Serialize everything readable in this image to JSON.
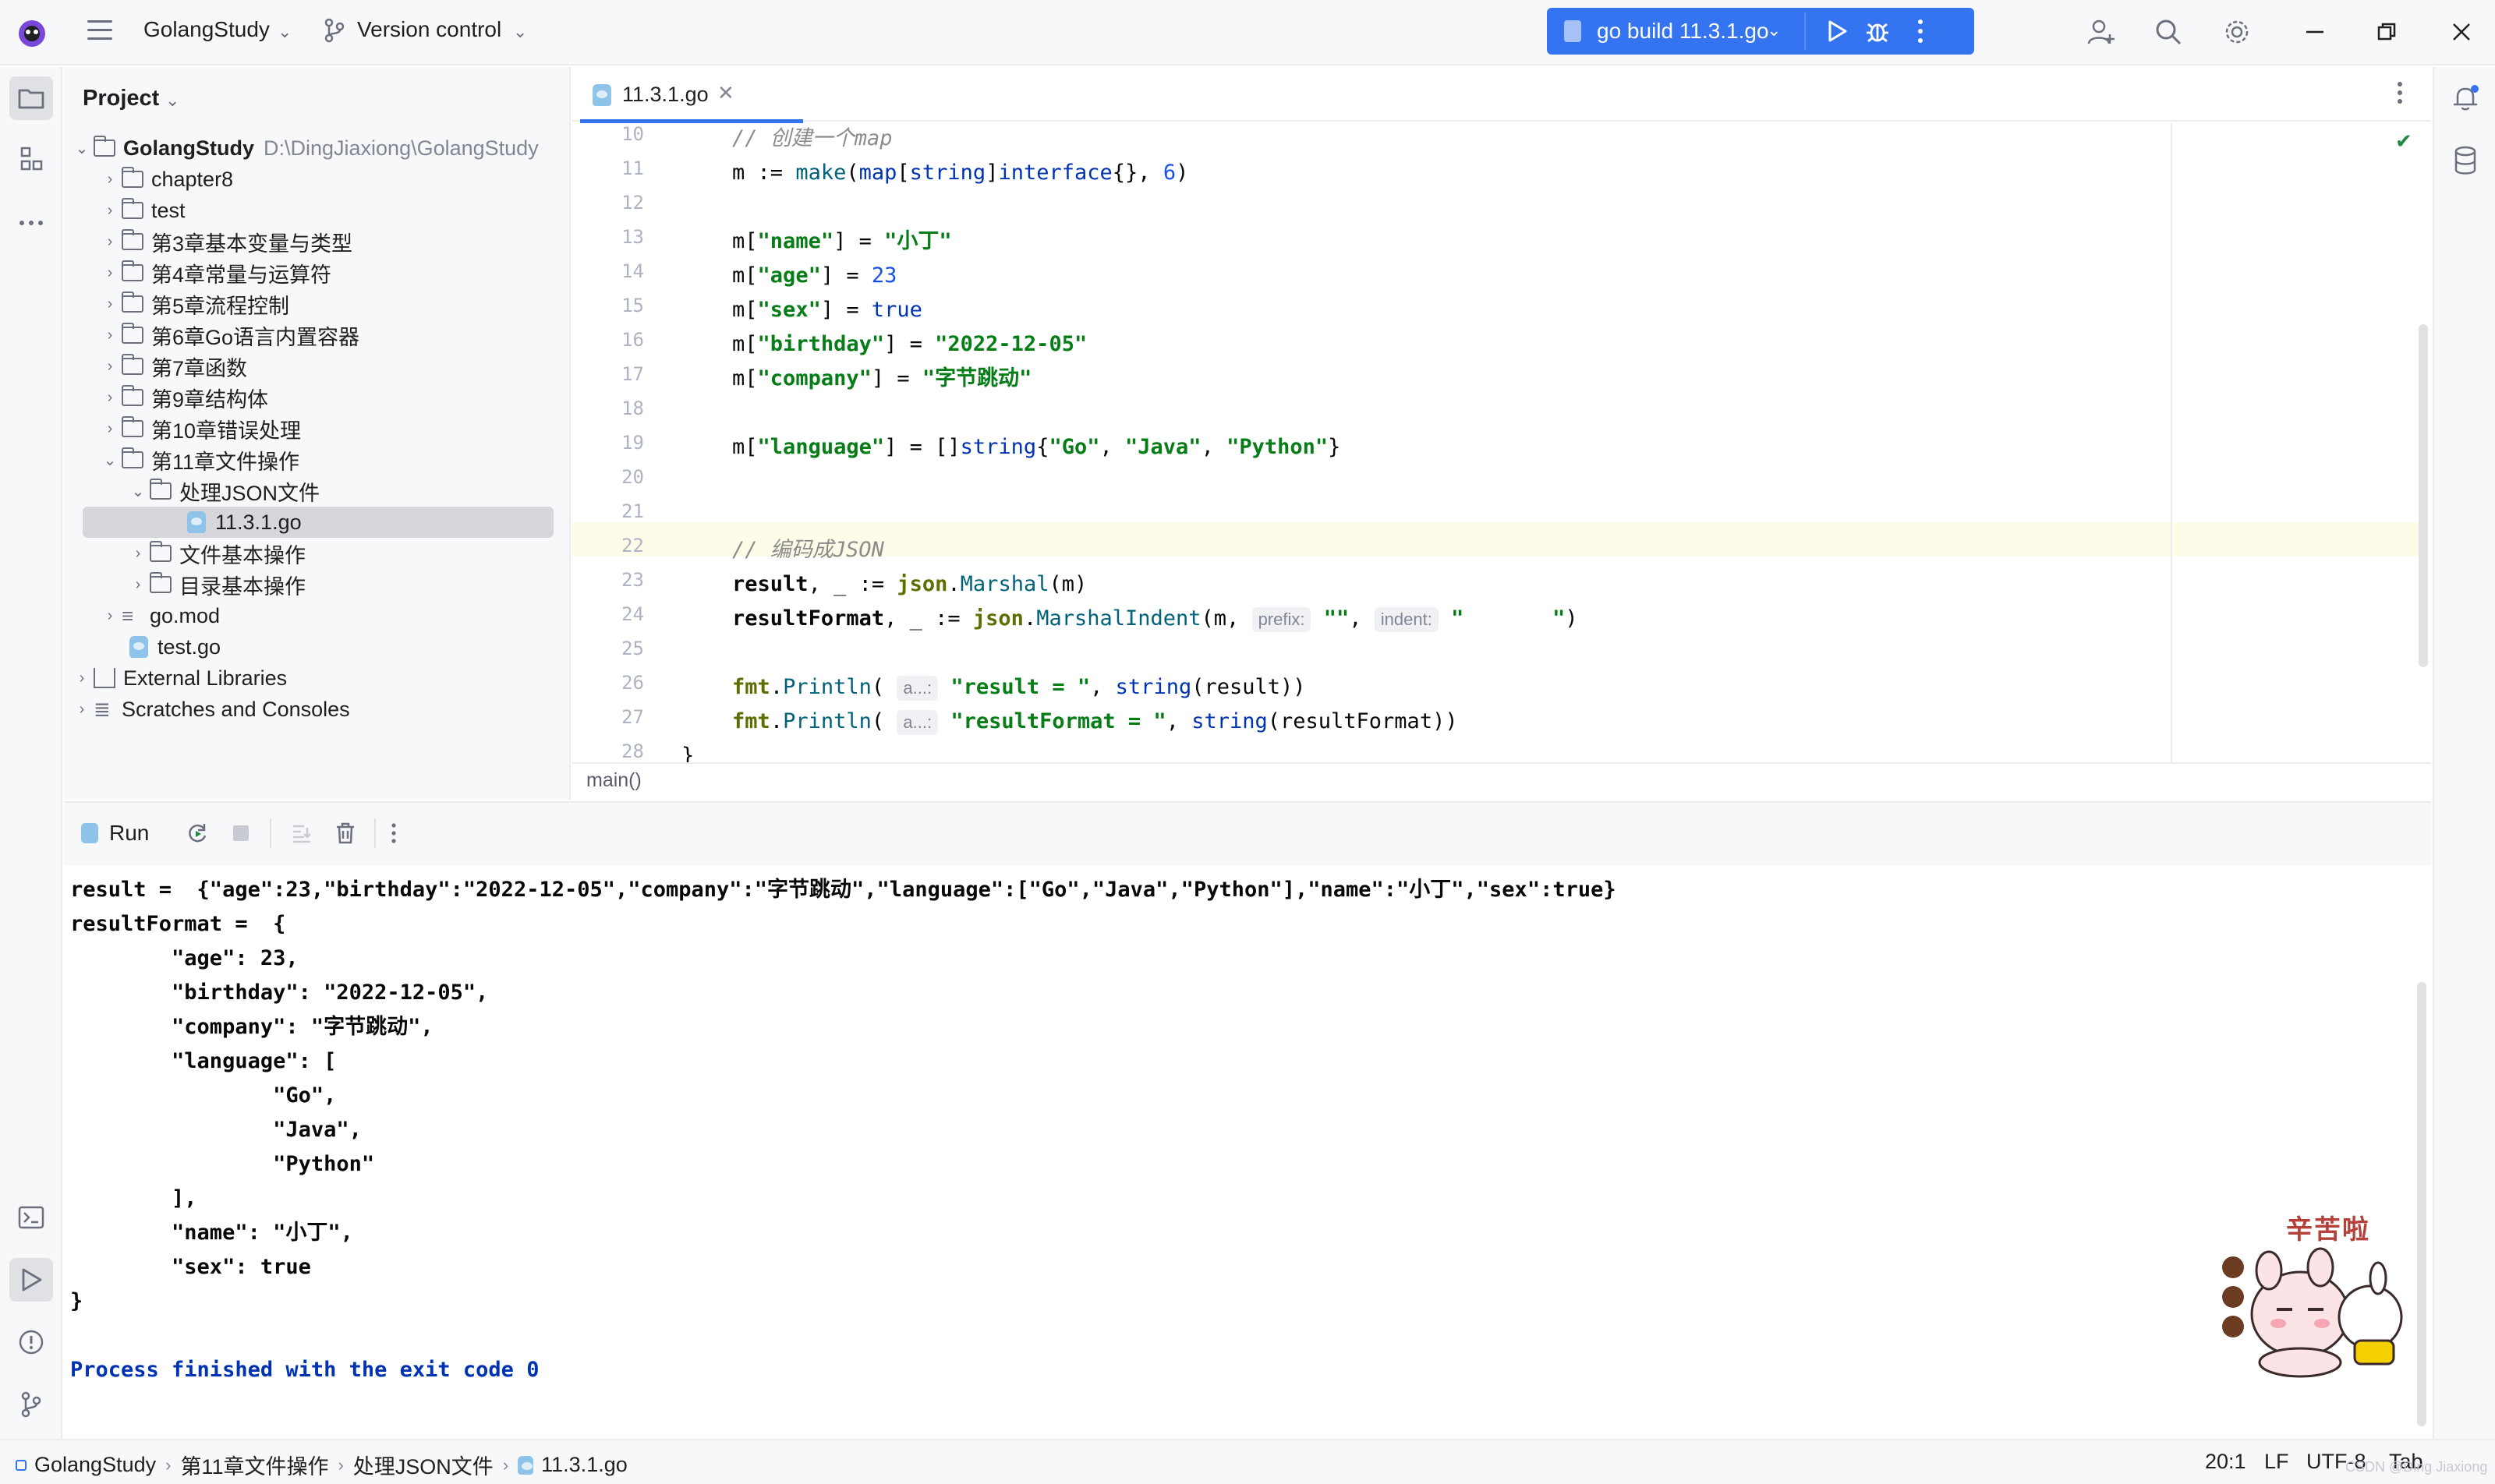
{
  "titlebar": {
    "project_name": "GolangStudy",
    "version_control": "Version control",
    "run_config": "go build 11.3.1.go"
  },
  "left_strip": {
    "icons": [
      "project-icon",
      "structure-icon",
      "more-icon",
      "terminal-icon",
      "run-icon",
      "problems-icon",
      "git-icon"
    ]
  },
  "project_panel": {
    "header": "Project",
    "root_name": "GolangStudy",
    "root_path": "D:\\DingJiaxiong\\GolangStudy",
    "items": [
      {
        "label": "chapter8"
      },
      {
        "label": "test"
      },
      {
        "label": "第3章基本变量与类型"
      },
      {
        "label": "第4章常量与运算符"
      },
      {
        "label": "第5章流程控制"
      },
      {
        "label": "第6章Go语言内置容器"
      },
      {
        "label": "第7章函数"
      },
      {
        "label": "第9章结构体"
      },
      {
        "label": "第10章错误处理"
      },
      {
        "label": "第11章文件操作"
      },
      {
        "label": "处理JSON文件"
      },
      {
        "label": "11.3.1.go"
      },
      {
        "label": "文件基本操作"
      },
      {
        "label": "目录基本操作"
      },
      {
        "label": "go.mod"
      },
      {
        "label": "test.go"
      },
      {
        "label": "External Libraries"
      },
      {
        "label": "Scratches and Consoles"
      }
    ]
  },
  "editor": {
    "tab_label": "11.3.1.go",
    "line_numbers": [
      "10",
      "11",
      "12",
      "13",
      "14",
      "15",
      "16",
      "17",
      "18",
      "19",
      "20",
      "21",
      "22",
      "23",
      "24",
      "25",
      "26",
      "27",
      "28"
    ],
    "breadcrumb": "main()",
    "hints": {
      "prefix": "prefix:",
      "indent": "indent:",
      "a": "a...:"
    }
  },
  "run_panel": {
    "tab_label": "Run",
    "output": [
      "result =  {\"age\":23,\"birthday\":\"2022-12-05\",\"company\":\"字节跳动\",\"language\":[\"Go\",\"Java\",\"Python\"],\"name\":\"小丁\",\"sex\":true}",
      "resultFormat =  {",
      "        \"age\": 23,",
      "        \"birthday\": \"2022-12-05\",",
      "        \"company\": \"字节跳动\",",
      "        \"language\": [",
      "                \"Go\",",
      "                \"Java\",",
      "                \"Python\"",
      "        ],",
      "        \"name\": \"小丁\",",
      "        \"sex\": true",
      "}",
      "",
      "Process finished with the exit code 0"
    ],
    "sticker_text": "辛苦啦"
  },
  "statusbar": {
    "crumbs": [
      "GolangStudy",
      "第11章文件操作",
      "处理JSON文件",
      "11.3.1.go"
    ],
    "position": "20:1",
    "line_sep": "LF",
    "encoding": "UTF-8",
    "indent": "Tab",
    "watermark": "CSDN @Ding Jiaxiong"
  },
  "colors": {
    "accent": "#3574f0",
    "keyword": "#0033b3",
    "string": "#067d17",
    "number": "#1750eb",
    "comment": "#8c8c8c"
  }
}
